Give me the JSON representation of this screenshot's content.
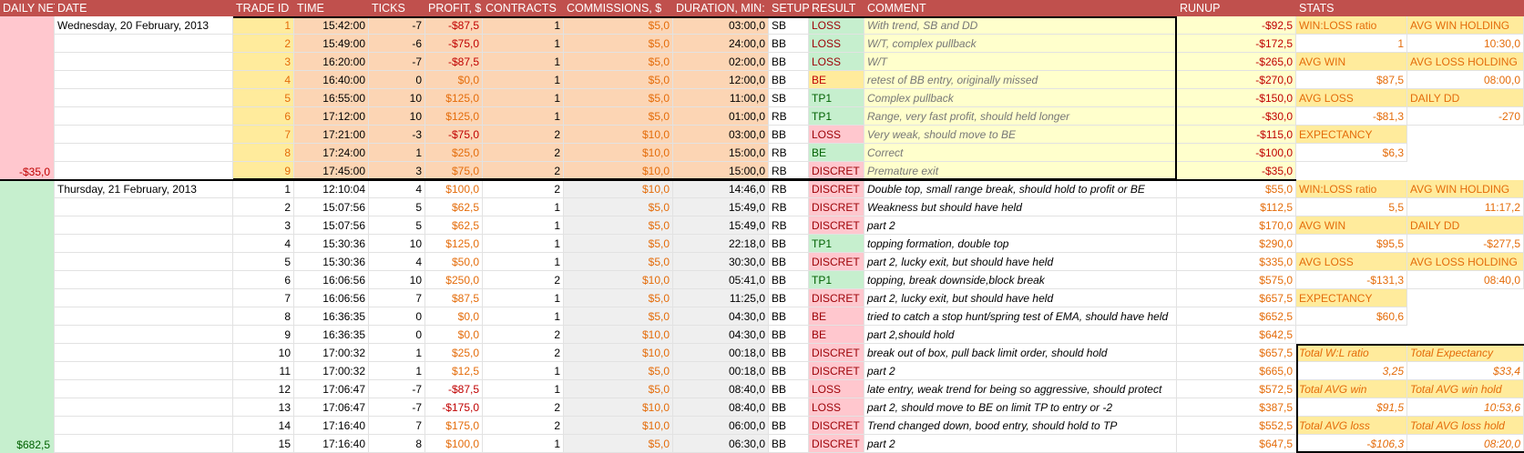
{
  "headers": {
    "daily_net": "DAILY NET",
    "date": "DATE",
    "trade_id": "TRADE ID",
    "time": "TIME",
    "ticks": "TICKS",
    "profit": "PROFIT, $",
    "contracts": "CONTRACTS",
    "commissions": "COMMISSIONS, $",
    "duration": "DURATION, MIN:",
    "setup": "SETUP",
    "result": "RESULT",
    "comment": "COMMENT",
    "runup": "RUNUP",
    "stats": "STATS"
  },
  "days": [
    {
      "date": "Wednesday, 20 February, 2013",
      "daily_net": "-$35,0",
      "trades": [
        {
          "id": "1",
          "time": "15:42:00",
          "ticks": "-7",
          "profit": "-$87,5",
          "contracts": "1",
          "commissions": "$5,0",
          "duration": "03:00,0",
          "setup": "SB",
          "result": "LOSS",
          "comment": "With trend, SB and DD",
          "runup": "-$92,5"
        },
        {
          "id": "2",
          "time": "15:49:00",
          "ticks": "-6",
          "profit": "-$75,0",
          "contracts": "1",
          "commissions": "$5,0",
          "duration": "24:00,0",
          "setup": "BB",
          "result": "LOSS",
          "comment": "W/T, complex pullback",
          "runup": "-$172,5"
        },
        {
          "id": "3",
          "time": "16:20:00",
          "ticks": "-7",
          "profit": "-$87,5",
          "contracts": "1",
          "commissions": "$5,0",
          "duration": "02:00,0",
          "setup": "BB",
          "result": "LOSS",
          "comment": "W/T",
          "runup": "-$265,0"
        },
        {
          "id": "4",
          "time": "16:40:00",
          "ticks": "0",
          "profit": "$0,0",
          "contracts": "1",
          "commissions": "$5,0",
          "duration": "12:00,0",
          "setup": "BB",
          "result": "BE",
          "comment": "retest of BB entry, originally missed",
          "runup": "-$270,0"
        },
        {
          "id": "5",
          "time": "16:55:00",
          "ticks": "10",
          "profit": "$125,0",
          "contracts": "1",
          "commissions": "$5,0",
          "duration": "11:00,0",
          "setup": "SB",
          "result": "TP1",
          "comment": "Complex pullback",
          "runup": "-$150,0"
        },
        {
          "id": "6",
          "time": "17:12:00",
          "ticks": "10",
          "profit": "$125,0",
          "contracts": "1",
          "commissions": "$5,0",
          "duration": "01:00,0",
          "setup": "RB",
          "result": "TP1",
          "comment": "Range, very fast profit, should held longer",
          "runup": "-$30,0"
        },
        {
          "id": "7",
          "time": "17:21:00",
          "ticks": "-3",
          "profit": "-$75,0",
          "contracts": "2",
          "commissions": "$10,0",
          "duration": "03:00,0",
          "setup": "BB",
          "result": "LOSS",
          "comment": "Very weak, should move to BE",
          "runup": "-$115,0"
        },
        {
          "id": "8",
          "time": "17:24:00",
          "ticks": "1",
          "profit": "$25,0",
          "contracts": "2",
          "commissions": "$10,0",
          "duration": "15:00,0",
          "setup": "RB",
          "result": "BE",
          "comment": "Correct",
          "runup": "-$100,0"
        },
        {
          "id": "9",
          "time": "17:45:00",
          "ticks": "3",
          "profit": "$75,0",
          "contracts": "2",
          "commissions": "$10,0",
          "duration": "15:00,0",
          "setup": "RB",
          "result": "DISCRET",
          "comment": "Premature exit",
          "runup": "-$35,0"
        }
      ]
    },
    {
      "date": "Thursday, 21 February, 2013",
      "daily_net": "$682,5",
      "trades": [
        {
          "id": "1",
          "time": "12:10:04",
          "ticks": "4",
          "profit": "$100,0",
          "contracts": "2",
          "commissions": "$10,0",
          "duration": "14:46,0",
          "setup": "RB",
          "result": "DISCRET",
          "comment": "Double top, small range break, should hold to profit or BE",
          "runup": "$55,0"
        },
        {
          "id": "2",
          "time": "15:07:56",
          "ticks": "5",
          "profit": "$62,5",
          "contracts": "1",
          "commissions": "$5,0",
          "duration": "15:49,0",
          "setup": "RB",
          "result": "DISCRET",
          "comment": "Weakness but should have held",
          "runup": "$112,5"
        },
        {
          "id": "3",
          "time": "15:07:56",
          "ticks": "5",
          "profit": "$62,5",
          "contracts": "1",
          "commissions": "$5,0",
          "duration": "15:49,0",
          "setup": "RB",
          "result": "DISCRET",
          "comment": "part 2",
          "runup": "$170,0"
        },
        {
          "id": "4",
          "time": "15:30:36",
          "ticks": "10",
          "profit": "$125,0",
          "contracts": "1",
          "commissions": "$5,0",
          "duration": "22:18,0",
          "setup": "BB",
          "result": "TP1",
          "comment": "topping formation, double top",
          "runup": "$290,0"
        },
        {
          "id": "5",
          "time": "15:30:36",
          "ticks": "4",
          "profit": "$50,0",
          "contracts": "1",
          "commissions": "$5,0",
          "duration": "30:30,0",
          "setup": "BB",
          "result": "DISCRET",
          "comment": "part 2, lucky exit, but should have held",
          "runup": "$335,0"
        },
        {
          "id": "6",
          "time": "16:06:56",
          "ticks": "10",
          "profit": "$250,0",
          "contracts": "2",
          "commissions": "$10,0",
          "duration": "05:41,0",
          "setup": "BB",
          "result": "TP1",
          "comment": "topping, break downside,block break",
          "runup": "$575,0"
        },
        {
          "id": "7",
          "time": "16:06:56",
          "ticks": "7",
          "profit": "$87,5",
          "contracts": "1",
          "commissions": "$5,0",
          "duration": "11:25,0",
          "setup": "BB",
          "result": "DISCRET",
          "comment": "part 2, lucky exit, but should have held",
          "runup": "$657,5"
        },
        {
          "id": "8",
          "time": "16:36:35",
          "ticks": "0",
          "profit": "$0,0",
          "contracts": "1",
          "commissions": "$5,0",
          "duration": "04:30,0",
          "setup": "BB",
          "result": "BE",
          "comment": "tried to catch a stop hunt/spring test of EMA, should have held",
          "runup": "$652,5"
        },
        {
          "id": "9",
          "time": "16:36:35",
          "ticks": "0",
          "profit": "$0,0",
          "contracts": "2",
          "commissions": "$10,0",
          "duration": "04:30,0",
          "setup": "BB",
          "result": "BE",
          "comment": "part 2,should hold",
          "runup": "$642,5"
        },
        {
          "id": "10",
          "time": "17:00:32",
          "ticks": "1",
          "profit": "$25,0",
          "contracts": "2",
          "commissions": "$10,0",
          "duration": "00:18,0",
          "setup": "BB",
          "result": "DISCRET",
          "comment": "break out of box, pull back limit order, should hold",
          "runup": "$657,5"
        },
        {
          "id": "11",
          "time": "17:00:32",
          "ticks": "1",
          "profit": "$12,5",
          "contracts": "1",
          "commissions": "$5,0",
          "duration": "00:18,0",
          "setup": "BB",
          "result": "DISCRET",
          "comment": "part 2",
          "runup": "$665,0"
        },
        {
          "id": "12",
          "time": "17:06:47",
          "ticks": "-7",
          "profit": "-$87,5",
          "contracts": "1",
          "commissions": "$5,0",
          "duration": "08:40,0",
          "setup": "BB",
          "result": "LOSS",
          "comment": "late entry, weak trend for being so aggressive, should protect",
          "runup": "$572,5"
        },
        {
          "id": "13",
          "time": "17:06:47",
          "ticks": "-7",
          "profit": "-$175,0",
          "contracts": "2",
          "commissions": "$10,0",
          "duration": "08:40,0",
          "setup": "BB",
          "result": "LOSS",
          "comment": "part 2, should move to BE on limit TP to entry or -2",
          "runup": "$387,5"
        },
        {
          "id": "14",
          "time": "17:16:40",
          "ticks": "7",
          "profit": "$175,0",
          "contracts": "2",
          "commissions": "$10,0",
          "duration": "06:00,0",
          "setup": "BB",
          "result": "DISCRET",
          "comment": "Trend changed down, bood entry, should hold to TP",
          "runup": "$552,5"
        },
        {
          "id": "15",
          "time": "17:16:40",
          "ticks": "8",
          "profit": "$100,0",
          "contracts": "1",
          "commissions": "$5,0",
          "duration": "06:30,0",
          "setup": "BB",
          "result": "DISCRET",
          "comment": "part 2",
          "runup": "$647,5"
        }
      ]
    }
  ],
  "stats": {
    "day1": {
      "win_loss_label": "WIN:LOSS ratio",
      "win_loss": "1",
      "avg_win_holding_label": "AVG WIN HOLDING",
      "avg_win_holding": "10:30,0",
      "avg_win_label": "AVG WIN",
      "avg_win": "$87,5",
      "avg_loss_holding_label": "AVG LOSS HOLDING",
      "avg_loss_holding": "08:00,0",
      "avg_loss_label": "AVG LOSS",
      "avg_loss": "-$81,3",
      "daily_dd_label": "DAILY DD",
      "daily_dd": "-270",
      "expectancy_label": "EXPECTANCY",
      "expectancy": "$6,3"
    },
    "day2": {
      "win_loss_label": "WIN:LOSS ratio",
      "win_loss": "5,5",
      "avg_win_holding_label": "AVG WIN HOLDING",
      "avg_win_holding": "11:17,2",
      "avg_win_label": "AVG WIN",
      "avg_win": "$95,5",
      "daily_dd_label": "DAILY DD",
      "daily_dd": "-$277,5",
      "avg_loss_label": "AVG LOSS",
      "avg_loss": "-$131,3",
      "avg_loss_holding_label": "AVG LOSS HOLDING",
      "avg_loss_holding": "08:40,0",
      "expectancy_label": "EXPECTANCY",
      "expectancy": "$60,6"
    },
    "totals": {
      "wl_ratio_label": "Total W:L ratio",
      "wl_ratio": "3,25",
      "expectancy_label": "Total Expectancy",
      "expectancy": "$33,4",
      "avg_win_label": "Total AVG win",
      "avg_win": "$91,5",
      "avg_win_hold_label": "Total AVG win hold",
      "avg_win_hold": "10:53,6",
      "avg_loss_label": "Total AVG loss",
      "avg_loss": "-$106,3",
      "avg_loss_hold_label": "Total AVG loss hold",
      "avg_loss_hold": "08:20,0"
    }
  },
  "colors": {
    "header_bg": "#c0504d",
    "loss_bg": "#ffc7ce",
    "win_bg": "#c6efce",
    "neutral_bg": "#ffeb9c",
    "money_text": "#e46c0a"
  }
}
